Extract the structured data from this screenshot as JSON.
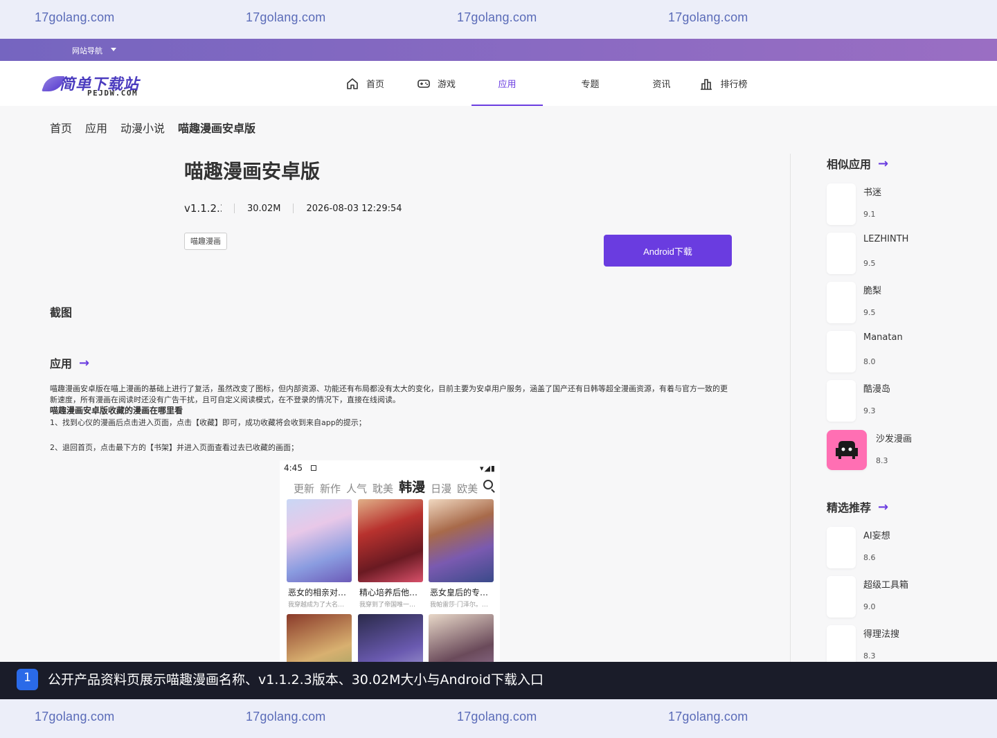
{
  "watermark": {
    "text": "17golang.com"
  },
  "site_nav": {
    "label": "网站导航"
  },
  "logo": {
    "cn": "简单下载站",
    "en": "PEJDW.COM"
  },
  "nav": {
    "items": [
      {
        "label": "首页",
        "icon": "home-icon"
      },
      {
        "label": "游戏",
        "icon": "gamepad-icon"
      },
      {
        "label": "应用",
        "icon": ""
      },
      {
        "label": "专题",
        "icon": ""
      },
      {
        "label": "资讯",
        "icon": ""
      },
      {
        "label": "排行榜",
        "icon": "ranking-icon"
      }
    ],
    "active": "应用"
  },
  "breadcrumb": [
    "首页",
    "应用",
    "动漫小说",
    "喵趣漫画安卓版"
  ],
  "app": {
    "title": "喵趣漫画安卓版",
    "version": "v1.1.2.3",
    "size": "30.02M",
    "date": "2026-08-03 12:29:54",
    "tag": "喵趣漫画",
    "download_label": "Android下载"
  },
  "sections": {
    "screenshots": "截图",
    "apps": "应用"
  },
  "description": {
    "p1": "喵趣漫画安卓版在喵上漫画的基础上进行了复活，虽然改变了图标，但内部资源、功能还有布局都没有太大的变化，目前主要为安卓用户服务，涵盖了国产还有日韩等超全漫画资源，有着与官方一致的更新速度，所有漫画在阅读时还没有广告干扰，且可自定义阅读模式，在不登录的情况下，直接在线阅读。",
    "heading": "喵趣漫画安卓版收藏的漫画在哪里看",
    "step1": "1、找到心仪的漫画后点击进入页面，点击【收藏】即可，成功收藏将会收到来自app的提示；",
    "step2": "2、退回首页，点击最下方的【书架】并进入页面查看过去已收藏的画面；"
  },
  "phone": {
    "time": "4:45",
    "tabs": [
      "更新",
      "新作",
      "人气",
      "耽美",
      "韩漫",
      "日漫",
      "欧美"
    ],
    "active_tab": "韩漫",
    "comics": [
      {
        "title": "恶女的相亲对…",
        "sub": "我穿越成为了大名…"
      },
      {
        "title": "精心培养后他…",
        "sub": "我穿到了帝国唯一…"
      },
      {
        "title": "恶女皇后的专…",
        "sub": "我帕雷莎·门泽尔。…"
      }
    ]
  },
  "sidebar": {
    "similar_title": "相似应用",
    "similar": [
      {
        "name": "书迷",
        "score": "9.1"
      },
      {
        "name": "LEZHINTH",
        "score": "9.5"
      },
      {
        "name": "脆梨",
        "score": "9.5"
      },
      {
        "name": "Manatan",
        "score": "8.0"
      },
      {
        "name": "酷漫岛",
        "score": "9.3"
      },
      {
        "name": "沙发漫画",
        "score": "8.3"
      }
    ],
    "featured_title": "精选推荐",
    "featured": [
      {
        "name": "AI妄想",
        "score": "8.6"
      },
      {
        "name": "超级工具箱",
        "score": "9.0"
      },
      {
        "name": "得理法搜",
        "score": "8.3"
      }
    ]
  },
  "caption": {
    "number": "1",
    "text": "公开产品资料页展示喵趣漫画名称、v1.1.2.3版本、30.02M大小与Android下载入口"
  },
  "colors": {
    "accent": "#6a3ce0",
    "nav_gradient_start": "#7565c0",
    "caption_bg": "#1a1c29",
    "sofa_icon_bg": "#ff6fb3"
  }
}
